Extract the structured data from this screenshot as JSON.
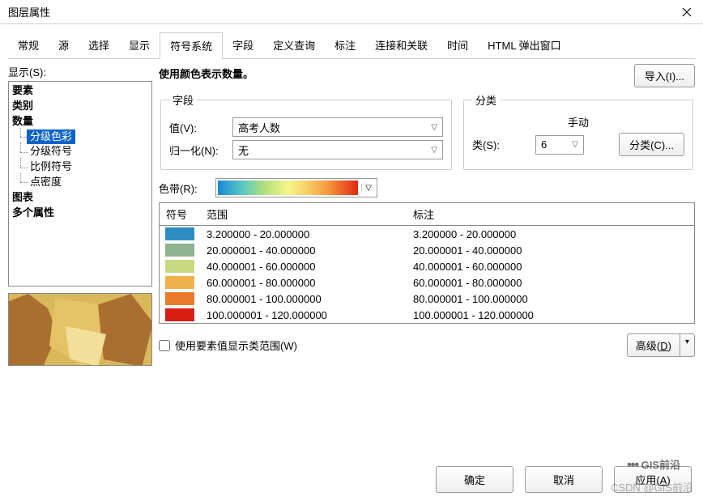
{
  "window": {
    "title": "图层属性"
  },
  "tabs": [
    "常规",
    "源",
    "选择",
    "显示",
    "符号系统",
    "字段",
    "定义查询",
    "标注",
    "连接和关联",
    "时间",
    "HTML 弹出窗口"
  ],
  "activeTab": "符号系统",
  "show_label": "显示(S):",
  "tree": {
    "roots": [
      "要素",
      "类别",
      "数量",
      "图表",
      "多个属性"
    ],
    "quantity_children": [
      "分级色彩",
      "分级符号",
      "比例符号",
      "点密度"
    ],
    "selected": "分级色彩"
  },
  "description": "使用颜色表示数量。",
  "import_btn": "导入(I)...",
  "fields_legend": "字段",
  "value_label": "值(V):",
  "value_selected": "高考人数",
  "normalize_label": "归一化(N):",
  "normalize_selected": "无",
  "classify_legend": "分类",
  "classify_method": "手动",
  "classes_label": "类(S):",
  "classes_value": "6",
  "classify_btn": "分类(C)...",
  "ribbon_label": "色带(R):",
  "table": {
    "headers": {
      "symbol": "符号",
      "range": "范围",
      "label": "标注"
    },
    "rows": [
      {
        "color": "#2d8cc0",
        "range": "3.200000 - 20.000000",
        "label": "3.200000 - 20.000000"
      },
      {
        "color": "#8fb48f",
        "range": "20.000001 - 40.000000",
        "label": "20.000001 - 40.000000"
      },
      {
        "color": "#c6d97e",
        "range": "40.000001 - 60.000000",
        "label": "40.000001 - 60.000000"
      },
      {
        "color": "#f0b04e",
        "range": "60.000001 - 80.000000",
        "label": "60.000001 - 80.000000"
      },
      {
        "color": "#ea7a2c",
        "range": "80.000001 - 100.000000",
        "label": "80.000001 - 100.000000"
      },
      {
        "color": "#d81e13",
        "range": "100.000001 - 120.000000",
        "label": "100.000001 - 120.000000"
      }
    ]
  },
  "use_feature_values": "使用要素值显示类范围(W)",
  "advanced_btn": "高级(D)",
  "footer": {
    "ok": "确定",
    "cancel": "取消",
    "apply": "应用(A)"
  },
  "watermark": {
    "brand": "GIS前沿",
    "csdn": "CSDN @GIS前沿"
  },
  "chart_data": {
    "type": "choropleth-classes",
    "field": "高考人数",
    "classes": 6,
    "method": "手动",
    "breaks": [
      3.2,
      20,
      40,
      60,
      80,
      100,
      120
    ],
    "colors": [
      "#2d8cc0",
      "#8fb48f",
      "#c6d97e",
      "#f0b04e",
      "#ea7a2c",
      "#d81e13"
    ]
  }
}
